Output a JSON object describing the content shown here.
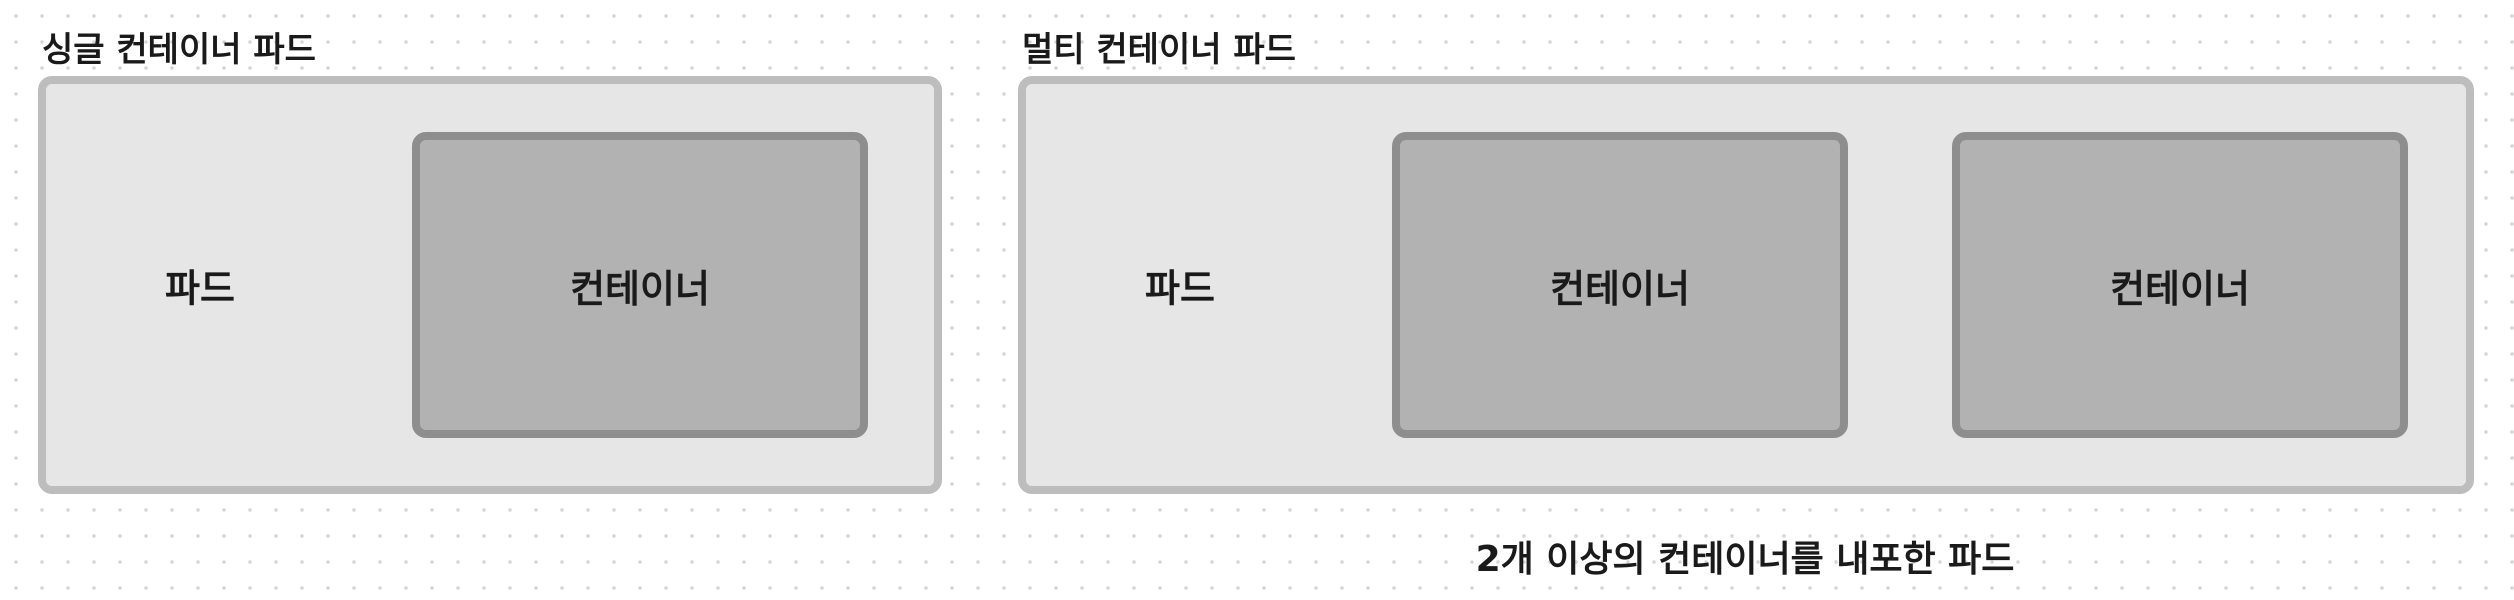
{
  "single_pod": {
    "title": "싱글 컨테이너 파드",
    "pod_label": "파드",
    "container_label": "컨테이너"
  },
  "multi_pod": {
    "title": "멀티 컨테이너 파드",
    "pod_label": "파드",
    "containers": [
      {
        "label": "컨테이너"
      },
      {
        "label": "컨테이너"
      }
    ],
    "caption": "2개 이상의 컨테이너를 내포한 파드"
  },
  "colors": {
    "pod_fill": "#e6e6e6",
    "pod_border": "#bdbdbd",
    "container_fill": "#b2b2b2",
    "container_border": "#8e8e8e",
    "text": "#1a1a1a"
  }
}
